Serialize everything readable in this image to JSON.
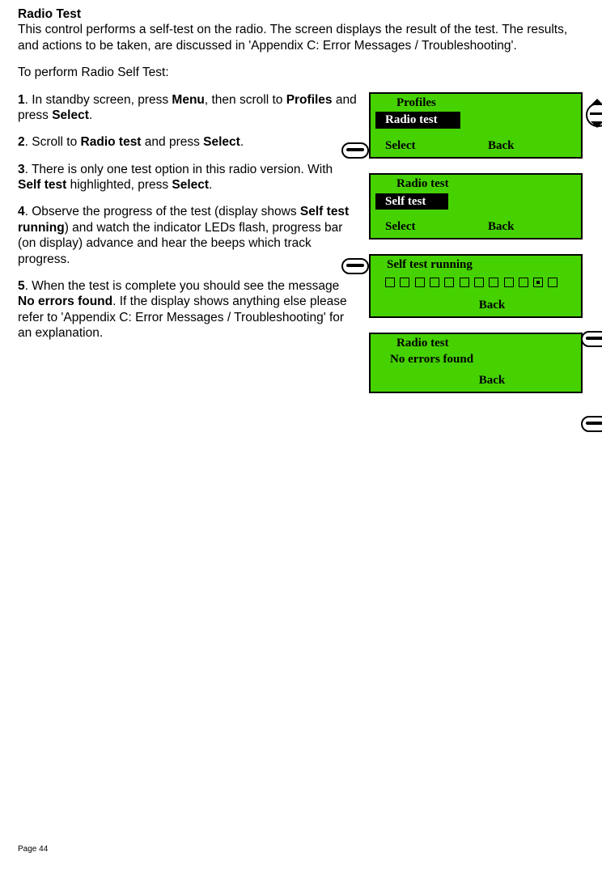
{
  "title": "Radio Test",
  "intro1": "This control performs a self-test on the radio. The screen displays the result of the test. The results, and actions to be taken, are discussed in 'Appendix C: Error Messages / Troubleshooting'.",
  "intro2": "To perform Radio Self Test:",
  "steps": {
    "s1_num": "1",
    "s1_a": ". In standby screen, press ",
    "s1_b": "Menu",
    "s1_c": ", then scroll to ",
    "s1_d": "Profiles",
    "s1_e": " and press ",
    "s1_f": "Select",
    "s1_g": ".",
    "s2_num": "2",
    "s2_a": ". Scroll to ",
    "s2_b": "Radio test",
    "s2_c": " and press ",
    "s2_d": "Select",
    "s2_e": ".",
    "s3_num": "3",
    "s3_a": ". There is only one test option in this radio version. With ",
    "s3_b": "Self test",
    "s3_c": " highlighted, press ",
    "s3_d": "Select",
    "s3_e": ".",
    "s4_num": "4",
    "s4_a": ". Observe the progress of the test (display shows ",
    "s4_b": "Self test running",
    "s4_c": ") and watch the indicator LEDs flash, progress bar (on display) advance and hear the beeps which track progress.",
    "s5_num": "5",
    "s5_a": ". When the test is complete you should see the message ",
    "s5_b": "No errors found",
    "s5_c": ". If the display shows anything else please refer to 'Appendix C: Error Messages / Troubleshooting' for an explanation."
  },
  "screens": {
    "scr1": {
      "line1": "Profiles",
      "highlight": "Radio test",
      "sk_left": "Select",
      "sk_right": "Back"
    },
    "scr2": {
      "line1": "Radio test",
      "highlight": "Self test",
      "sk_left": "Select",
      "sk_right": "Back"
    },
    "scr3": {
      "line1": "Self test running",
      "sk_right": "Back"
    },
    "scr4": {
      "line1": "Radio test",
      "line2": "No errors found",
      "sk_right": "Back"
    }
  },
  "footer": "Page 44"
}
